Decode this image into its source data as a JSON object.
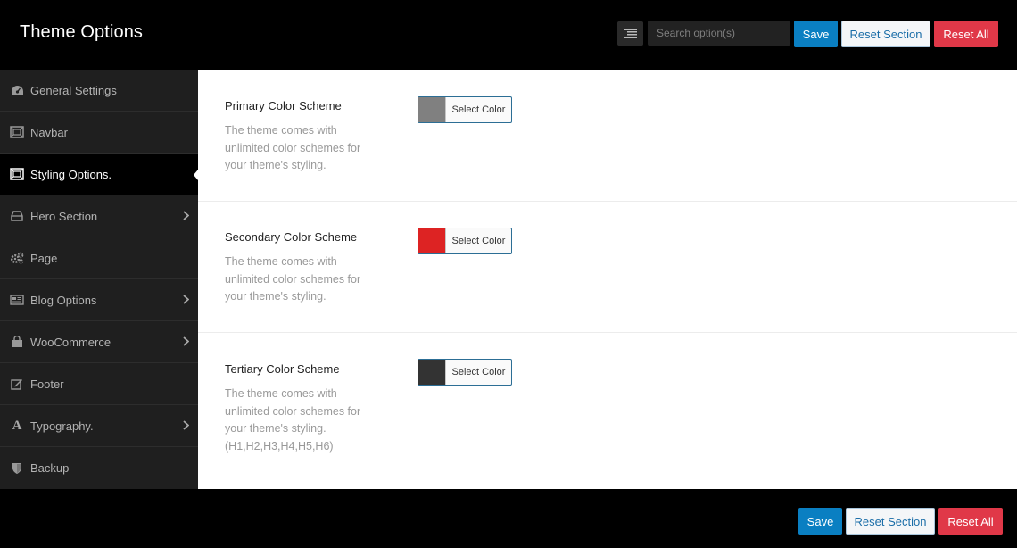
{
  "header": {
    "title": "Theme Options",
    "search_placeholder": "Search option(s)",
    "save_label": "Save",
    "reset_section_label": "Reset Section",
    "reset_all_label": "Reset All"
  },
  "sidebar": {
    "items": [
      {
        "label": "General Settings",
        "icon": "dashboard-icon",
        "has_submenu": false,
        "active": false
      },
      {
        "label": "Navbar",
        "icon": "screen-icon",
        "has_submenu": false,
        "active": false
      },
      {
        "label": "Styling Options.",
        "icon": "screen-icon",
        "has_submenu": false,
        "active": true
      },
      {
        "label": "Hero Section",
        "icon": "hdd-icon",
        "has_submenu": true,
        "active": false
      },
      {
        "label": "Page",
        "icon": "cogs-icon",
        "has_submenu": false,
        "active": false
      },
      {
        "label": "Blog Options",
        "icon": "newspaper-icon",
        "has_submenu": true,
        "active": false
      },
      {
        "label": "WooCommerce",
        "icon": "shopping-bag-icon",
        "has_submenu": true,
        "active": false
      },
      {
        "label": "Footer",
        "icon": "edit-icon",
        "has_submenu": false,
        "active": false
      },
      {
        "label": "Typography.",
        "icon": "font-icon",
        "has_submenu": true,
        "active": false
      },
      {
        "label": "Backup",
        "icon": "shield-icon",
        "has_submenu": false,
        "active": false
      }
    ]
  },
  "options": [
    {
      "title": "Primary Color Scheme",
      "desc_lines": [
        "The theme comes with",
        "unlimited color schemes for",
        "your theme's styling."
      ],
      "picker_label": "Select Color",
      "color": "#808080"
    },
    {
      "title": "Secondary Color Scheme",
      "desc_lines": [
        "The theme comes with",
        "unlimited color schemes for",
        "your theme's styling."
      ],
      "picker_label": "Select Color",
      "color": "#dd2323"
    },
    {
      "title": "Tertiary Color Scheme",
      "desc_lines": [
        "The theme comes with",
        "unlimited color schemes for",
        "your theme's styling.",
        "(H1,H2,H3,H4,H5,H6)"
      ],
      "picker_label": "Select Color",
      "color": "#333333"
    }
  ],
  "footer": {
    "save_label": "Save",
    "reset_section_label": "Reset Section",
    "reset_all_label": "Reset All"
  },
  "colors": {
    "save": "#0a7fc2",
    "reset_all": "#e03848",
    "sidebar_bg": "#1f1f1f",
    "header_bg": "#000000"
  }
}
